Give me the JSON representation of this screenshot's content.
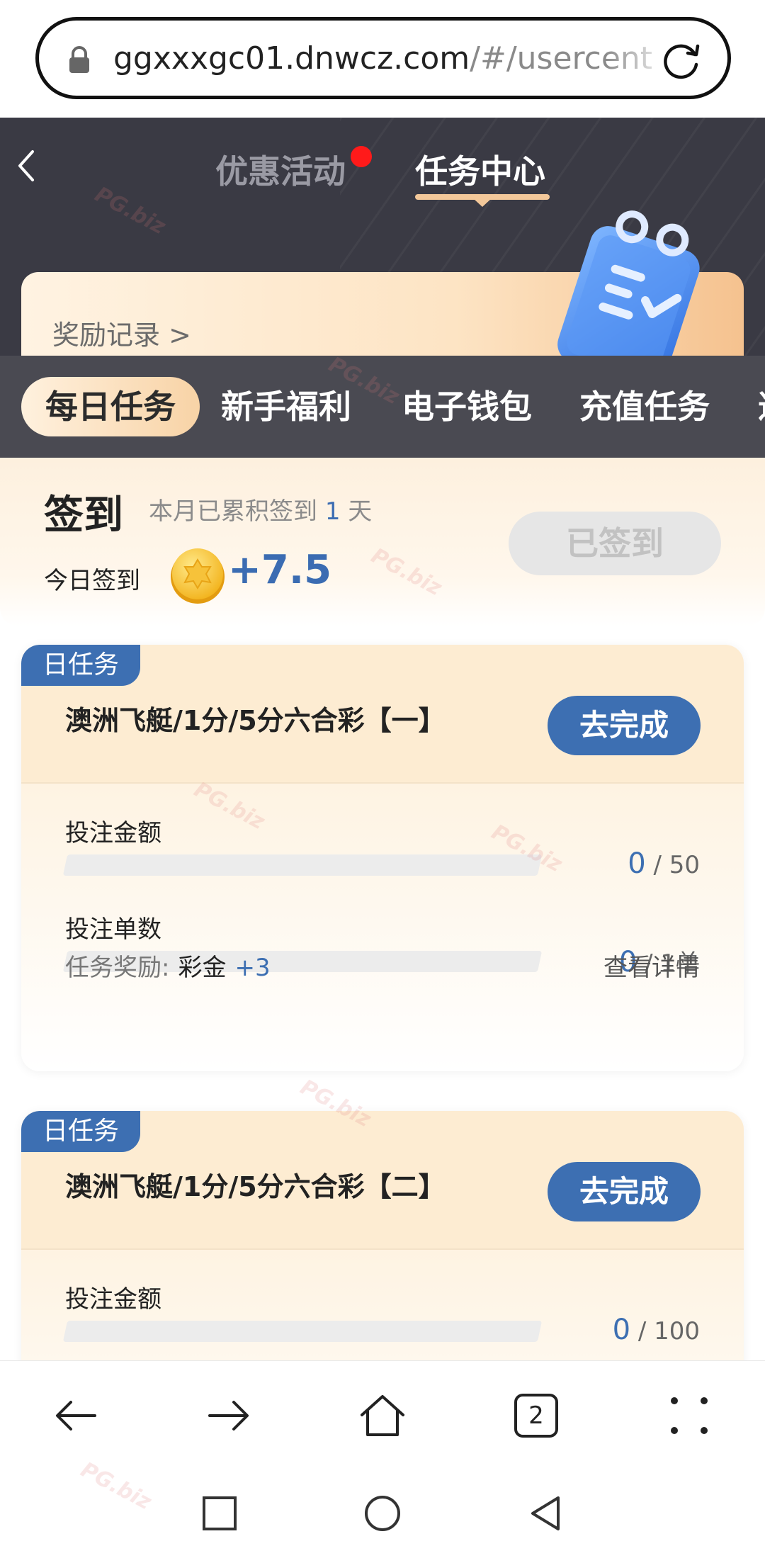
{
  "browser": {
    "url_main": "ggxxxgc01.dnwcz.com",
    "url_rest": "/#/usercent"
  },
  "header": {
    "tab_promo": "优惠活动",
    "tab_task": "任务中心",
    "reward_record": "奖励记录 >"
  },
  "categories": [
    "每日任务",
    "新手福利",
    "电子钱包",
    "充值任务",
    "邀"
  ],
  "signin": {
    "title": "签到",
    "sub_prefix": "本月已累积签到",
    "days": "1",
    "sub_suffix": "天",
    "today_label": "今日签到",
    "reward": "+7.5",
    "button": "已签到"
  },
  "tasks": [
    {
      "badge": "日任务",
      "title": "澳洲飞艇/1分/5分六合彩【一】",
      "button": "去完成",
      "metric1_label": "投注金额",
      "metric1_current": "0",
      "metric1_total": " / 50",
      "metric1_progress": 0,
      "metric2_label": "投注单数",
      "metric2_current": "0",
      "metric2_total": " / 1单",
      "metric2_progress": 0,
      "reward_label": "任务奖励:",
      "reward_type": "彩金",
      "reward_amount": "+3",
      "detail": "查看详情"
    },
    {
      "badge": "日任务",
      "title": "澳洲飞艇/1分/5分六合彩【二】",
      "button": "去完成",
      "metric1_label": "投注金额",
      "metric1_current": "0",
      "metric1_total": " / 100",
      "metric1_progress": 0
    }
  ],
  "browser_nav": {
    "tab_count": "2"
  },
  "watermark": "PG.biz",
  "colors": {
    "accent_blue": "#3d6fb2",
    "header_dark": "#3a3a44",
    "notification_red": "#ff1a1a",
    "gold_underline": "#f3c89a"
  }
}
